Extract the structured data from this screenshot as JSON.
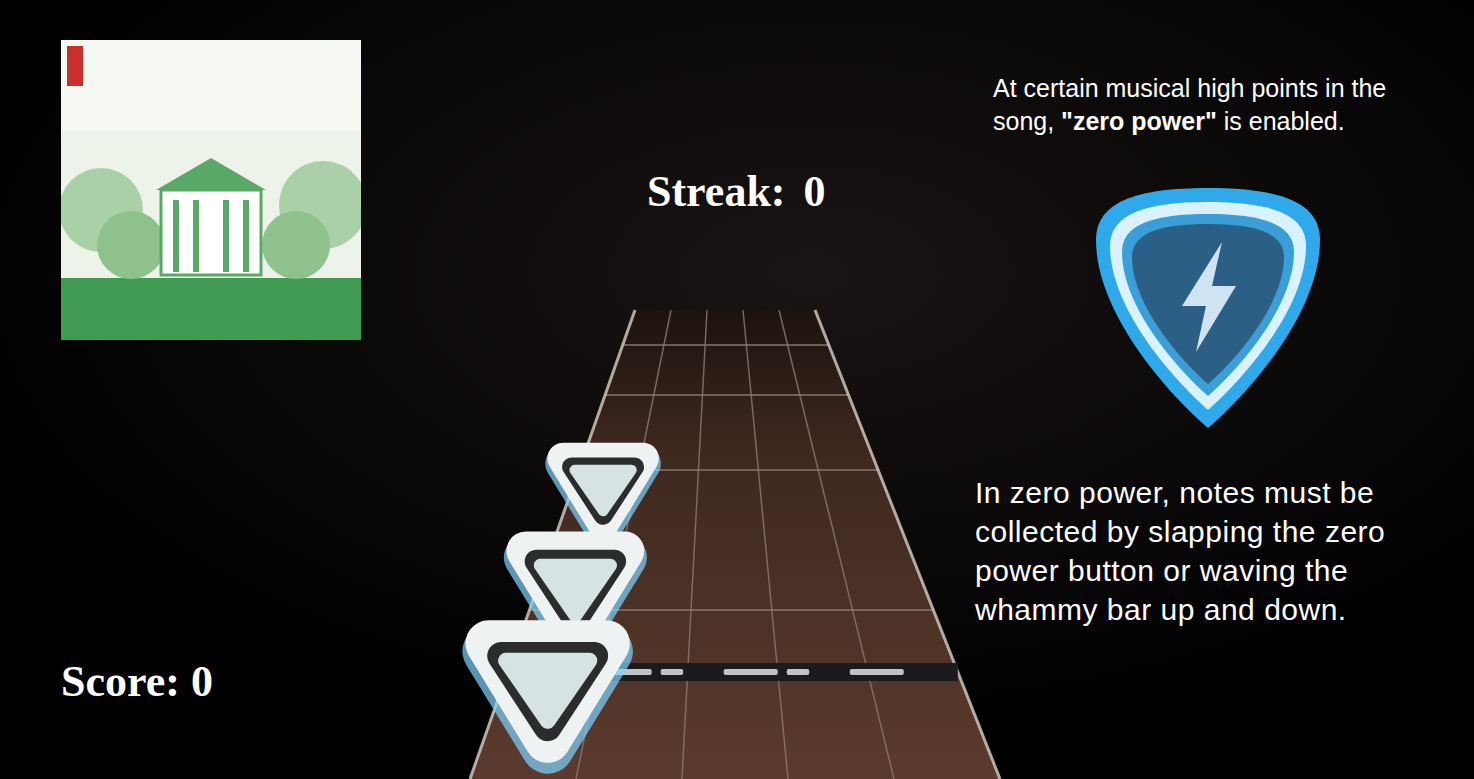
{
  "hud": {
    "streak_label": "Streak:",
    "streak": "0",
    "score_label": "Score:",
    "score": "0"
  },
  "info": {
    "intro_before": "At certain musical high points in the song, ",
    "intro_term": "\"zero power\"",
    "intro_after": " is enabled.",
    "detail": "In zero power, notes must be collected by slapping the zero power button or waving the whammy bar up and down."
  },
  "highway": {
    "lanes": 5,
    "notes": [
      {
        "lane": 0
      },
      {
        "lane": 0
      },
      {
        "lane": 0
      }
    ]
  }
}
